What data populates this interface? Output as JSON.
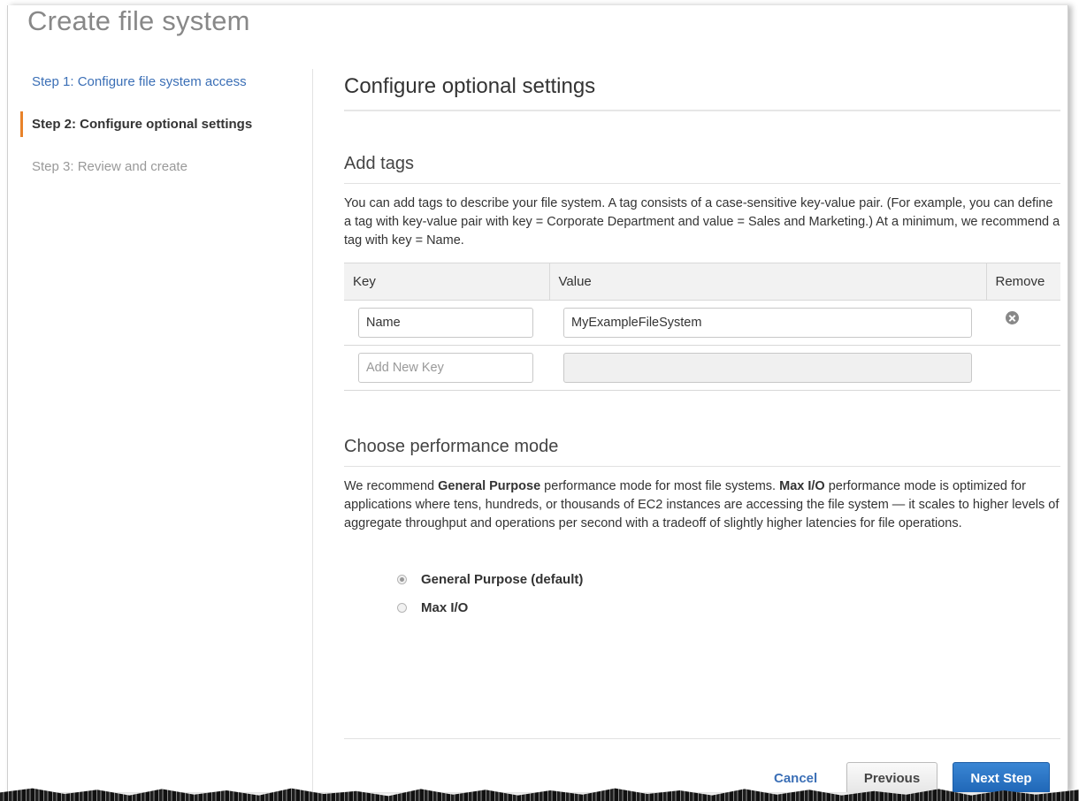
{
  "page": {
    "title": "Create file system"
  },
  "steps": [
    {
      "label": "Step 1: Configure file system access",
      "state": "done"
    },
    {
      "label": "Step 2: Configure optional settings",
      "state": "active"
    },
    {
      "label": "Step 3: Review and create",
      "state": "future"
    }
  ],
  "main": {
    "title": "Configure optional settings",
    "tags": {
      "title": "Add tags",
      "description": "You can add tags to describe your file system. A tag consists of a case-sensitive key-value pair. (For example, you can define a tag with key-value pair with key = Corporate Department and value = Sales and Marketing.) At a minimum, we recommend a tag with key = Name.",
      "columns": {
        "key": "Key",
        "value": "Value",
        "remove": "Remove"
      },
      "rows": [
        {
          "key": "Name",
          "value": "MyExampleFileSystem"
        }
      ],
      "new_key_placeholder": "Add New Key"
    },
    "performance": {
      "title": "Choose performance mode",
      "desc_1": "We recommend ",
      "desc_bold_1": "General Purpose",
      "desc_2": " performance mode for most file systems. ",
      "desc_bold_2": "Max I/O",
      "desc_3": " performance mode is optimized for applications where tens, hundreds, or thousands of EC2 instances are accessing the file system — it scales to higher levels of aggregate throughput and operations per second with a tradeoff of slightly higher latencies for file operations.",
      "options": [
        {
          "label": "General Purpose (default)",
          "selected": true
        },
        {
          "label": "Max I/O",
          "selected": false
        }
      ]
    }
  },
  "footer": {
    "cancel": "Cancel",
    "previous": "Previous",
    "next": "Next Step"
  },
  "colors": {
    "link": "#3b6fb6",
    "active_step_marker": "#e8822a",
    "primary_button": "#2a74c5"
  }
}
